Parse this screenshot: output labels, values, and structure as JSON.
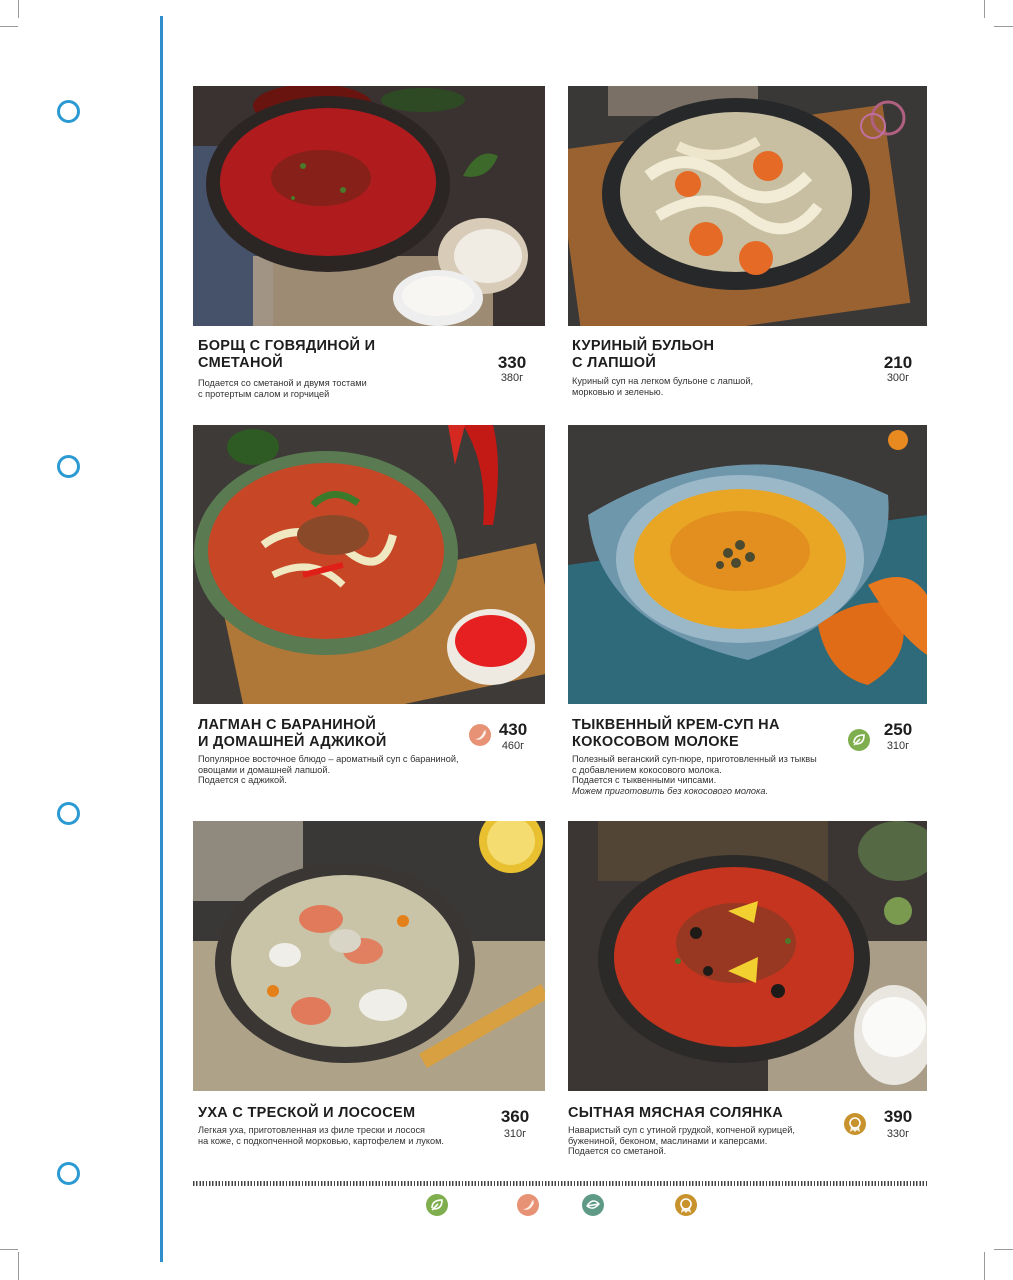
{
  "colors": {
    "spine": "#2f8fcc",
    "hole": "#2c9ad2",
    "vegan": "#7fae4e",
    "spicy": "#e79274",
    "chips": "#5e9a86",
    "chef": "#c8922c"
  },
  "dishes": [
    {
      "title_lines": [
        "БОРЩ С ГОВЯДИНОЙ И",
        "СМЕТАНОЙ"
      ],
      "desc_lines": [
        "Подается со сметаной и двумя тостами",
        "с протертым салом и горчицей"
      ],
      "price": "330",
      "weight": "380г",
      "badge": ""
    },
    {
      "title_lines": [
        "КУРИНЫЙ БУЛЬОН",
        "С ЛАПШОЙ"
      ],
      "desc_lines": [
        "Куриный суп на легком бульоне с лапшой,",
        "морковью и зеленью."
      ],
      "price": "210",
      "weight": "300г",
      "badge": ""
    },
    {
      "title_lines": [
        "ЛАГМАН С БАРАНИНОЙ",
        "И ДОМАШНЕЙ АДЖИКОЙ"
      ],
      "desc_lines": [
        "Популярное восточное блюдо –  ароматный суп с бараниной,",
        "овощами и домашней лапшой.",
        "Подается с аджикой."
      ],
      "price": "430",
      "weight": "460г",
      "badge": "chili-pepper-icon"
    },
    {
      "title_lines": [
        "ТЫКВЕННЫЙ КРЕМ-СУП НА",
        "КОКОСОВОМ МОЛОКЕ"
      ],
      "desc_lines": [
        "Полезный веганский суп-пюре, приготовленный из тыквы",
        "с добавлением кокосового молока.",
        "Подается с тыквенными чипсами."
      ],
      "note": "Можем приготовить без кокосового молока.",
      "price": "250",
      "weight": "310г",
      "badge": "vegan-leaf-icon"
    },
    {
      "title_lines": [
        "УХА С ТРЕСКОЙ И ЛОСОСЕМ"
      ],
      "desc_lines": [
        "Легкая уха, приготовленная из филе трески и лосося",
        "на коже, с подкопченной морковью, картофелем и луком."
      ],
      "price": "360",
      "weight": "310г",
      "badge": ""
    },
    {
      "title_lines": [
        "СЫТНАЯ МЯСНАЯ СОЛЯНКА"
      ],
      "desc_lines": [
        "Наваристый суп с утиной грудкой, копченой курицей,",
        "бужениной, беконом, маслинами и каперсами.",
        "Подается со сметаной."
      ],
      "price": "390",
      "weight": "330г",
      "badge": "chef-medal-icon"
    }
  ],
  "legend_icons": [
    "vegan-leaf-icon",
    "chili-pepper-icon",
    "teal-leaf-icon",
    "chef-medal-icon"
  ]
}
